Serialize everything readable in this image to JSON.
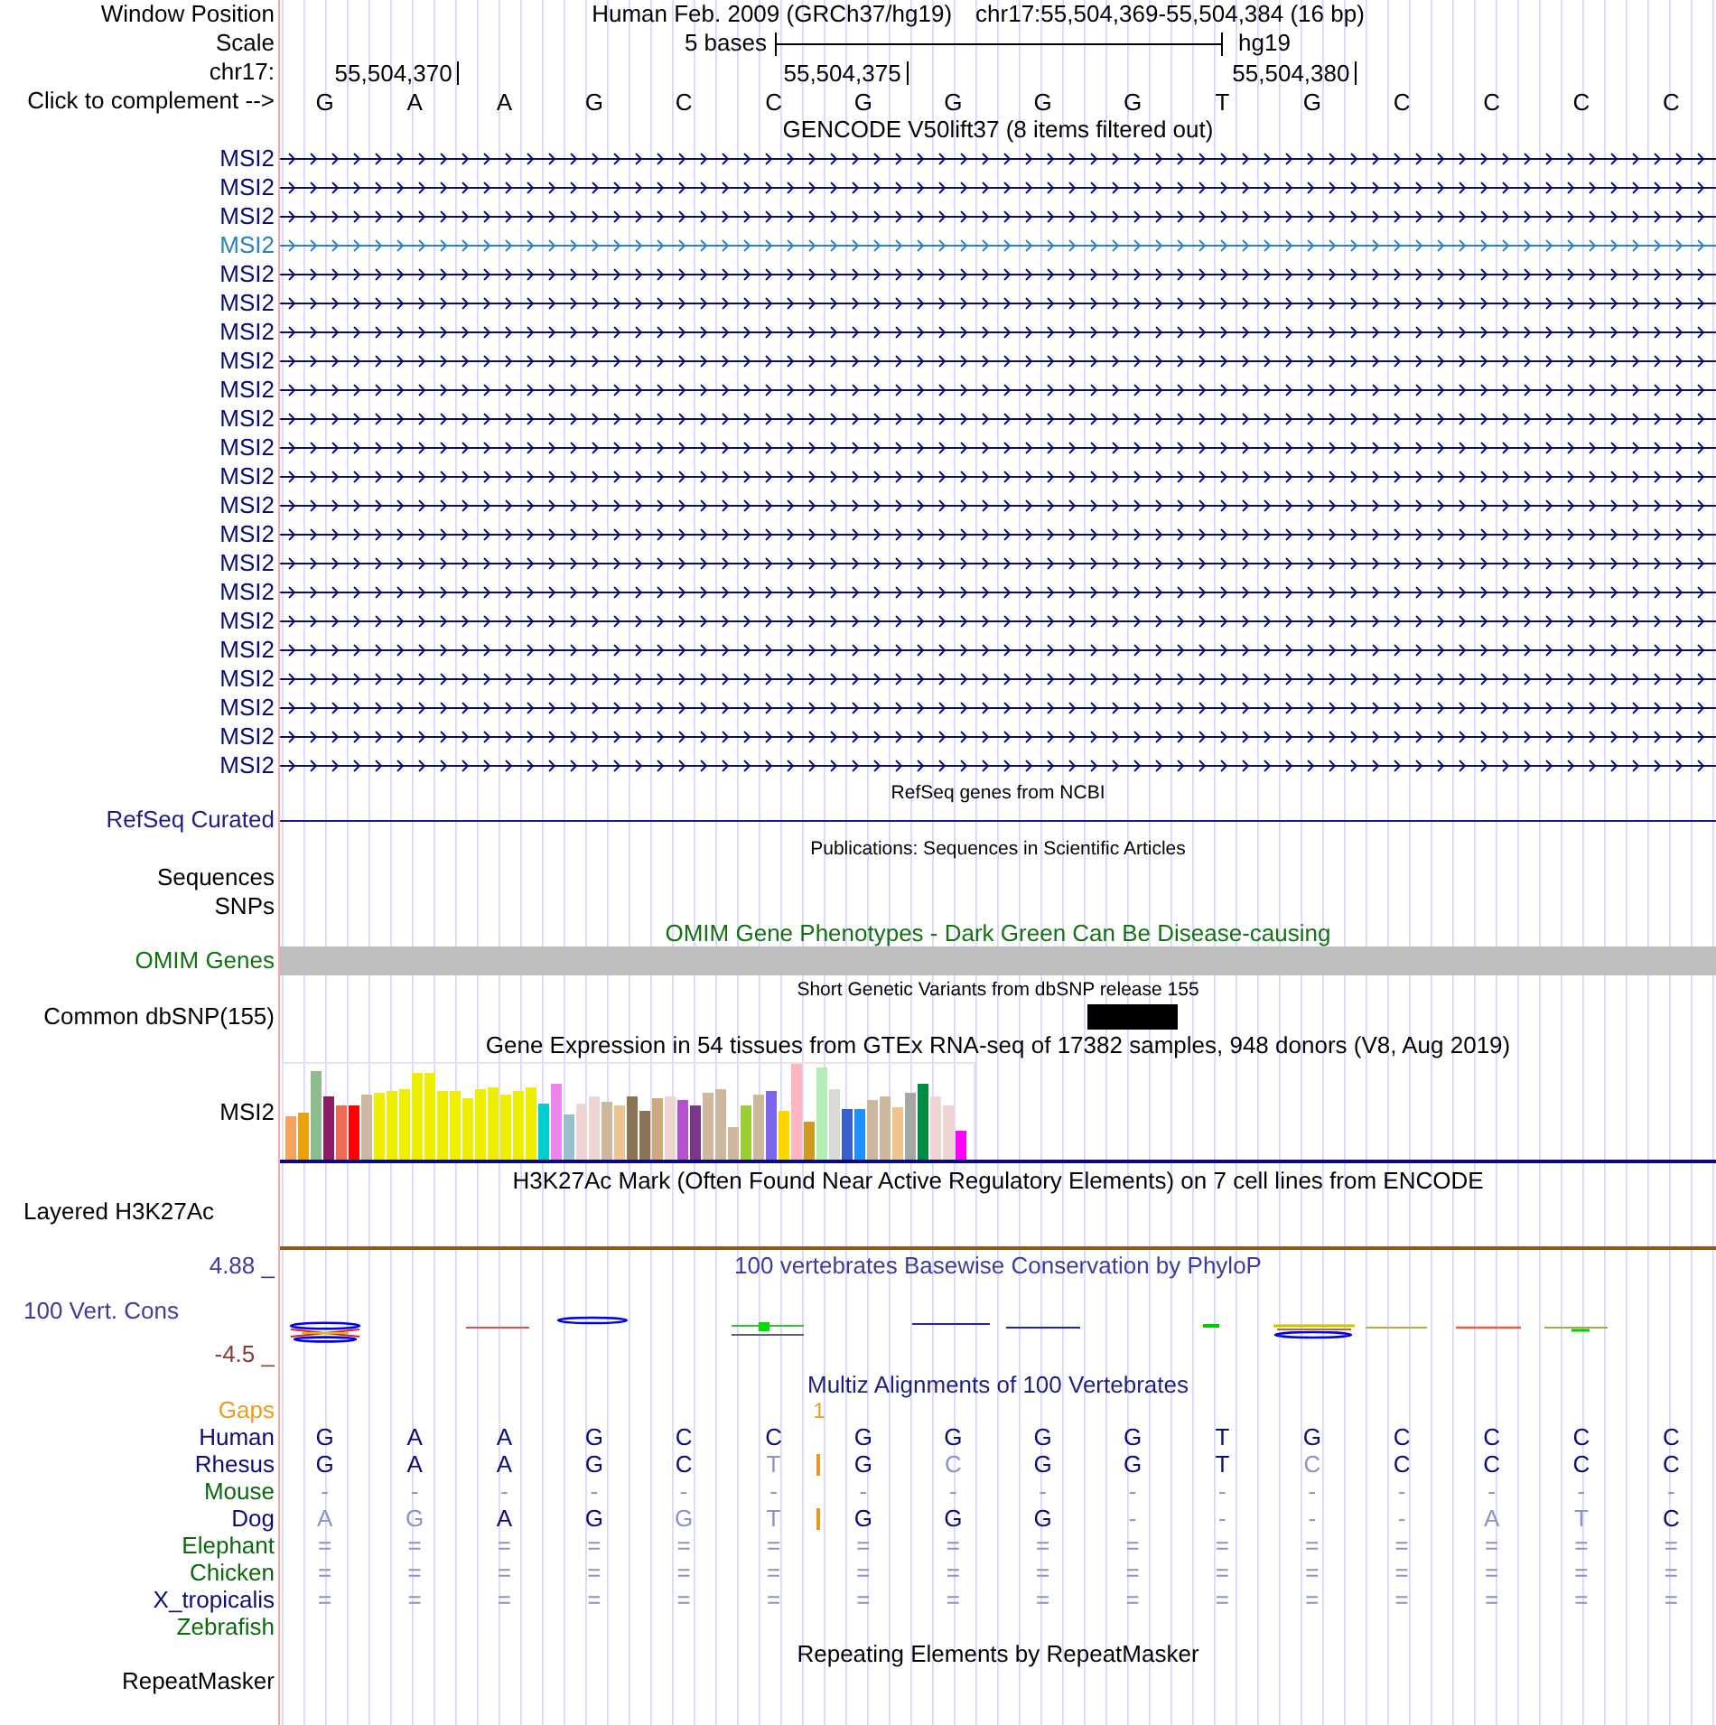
{
  "header": {
    "label": "Window Position",
    "assembly": "Human Feb. 2009 (GRCh37/hg19)",
    "position": "chr17:55,504,369-55,504,384 (16 bp)"
  },
  "scale": {
    "label": "Scale",
    "span": "5 bases",
    "assembly": "hg19"
  },
  "ruler": {
    "label": "chr17:",
    "positions": [
      "55,504,370",
      "55,504,375",
      "55,504,380"
    ]
  },
  "complement": {
    "label": "Click to complement -->",
    "bases": [
      "G",
      "A",
      "A",
      "G",
      "C",
      "C",
      "G",
      "G",
      "G",
      "G",
      "T",
      "G",
      "C",
      "C",
      "C",
      "C"
    ]
  },
  "gencode": {
    "title": "GENCODE V50lift37 (8 items filtered out)",
    "genes": [
      {
        "name": "MSI2",
        "color": "#0c0c78"
      },
      {
        "name": "MSI2",
        "color": "#0c0c78"
      },
      {
        "name": "MSI2",
        "color": "#0c0c78"
      },
      {
        "name": "MSI2",
        "color": "#2a82c4"
      },
      {
        "name": "MSI2",
        "color": "#0c0c78"
      },
      {
        "name": "MSI2",
        "color": "#0c0c78"
      },
      {
        "name": "MSI2",
        "color": "#0c0c78"
      },
      {
        "name": "MSI2",
        "color": "#0c0c78"
      },
      {
        "name": "MSI2",
        "color": "#0c0c78"
      },
      {
        "name": "MSI2",
        "color": "#0c0c78"
      },
      {
        "name": "MSI2",
        "color": "#0c0c78"
      },
      {
        "name": "MSI2",
        "color": "#0c0c78"
      },
      {
        "name": "MSI2",
        "color": "#0c0c78"
      },
      {
        "name": "MSI2",
        "color": "#0c0c78"
      },
      {
        "name": "MSI2",
        "color": "#0c0c78"
      },
      {
        "name": "MSI2",
        "color": "#0c0c78"
      },
      {
        "name": "MSI2",
        "color": "#0c0c78"
      },
      {
        "name": "MSI2",
        "color": "#0c0c78"
      },
      {
        "name": "MSI2",
        "color": "#0c0c78"
      },
      {
        "name": "MSI2",
        "color": "#0c0c78"
      },
      {
        "name": "MSI2",
        "color": "#0c0c78"
      },
      {
        "name": "MSI2",
        "color": "#0c0c78"
      }
    ]
  },
  "refseq": {
    "title": "RefSeq genes from NCBI",
    "label": "RefSeq Curated"
  },
  "publications": {
    "title": "Publications: Sequences in Scientific Articles",
    "labels": [
      "Sequences",
      "SNPs"
    ]
  },
  "omim": {
    "title": "OMIM Gene Phenotypes - Dark Green Can Be Disease-causing",
    "label": "OMIM Genes"
  },
  "dbsnp": {
    "title": "Short Genetic Variants from dbSNP release 155",
    "label": "Common dbSNP(155)"
  },
  "gtex": {
    "title": "Gene Expression in 54 tissues from GTEx RNA-seq of 17382 samples, 948 donors (V8, Aug 2019)",
    "label": "MSI2"
  },
  "h3k27ac": {
    "title": "H3K27Ac Mark (Often Found Near Active Regulatory Elements) on 7 cell lines from ENCODE",
    "label": "Layered H3K27Ac"
  },
  "phylop": {
    "title": "100 vertebrates Basewise Conservation by PhyloP",
    "label": "100 Vert. Cons",
    "max": "4.88 _",
    "min": "-4.5 _"
  },
  "multiz": {
    "title": "Multiz Alignments of 100 Vertebrates",
    "gaps": {
      "label": "Gaps",
      "count": "1"
    },
    "species": [
      {
        "name": "Human",
        "color": "#0c0c78",
        "insertion": false,
        "bases": [
          {
            "base": "G",
            "dim": false
          },
          {
            "base": "A",
            "dim": false
          },
          {
            "base": "A",
            "dim": false
          },
          {
            "base": "G",
            "dim": false
          },
          {
            "base": "C",
            "dim": false
          },
          {
            "base": "C",
            "dim": false
          },
          {
            "base": "G",
            "dim": false
          },
          {
            "base": "G",
            "dim": false
          },
          {
            "base": "G",
            "dim": false
          },
          {
            "base": "G",
            "dim": false
          },
          {
            "base": "T",
            "dim": false
          },
          {
            "base": "G",
            "dim": false
          },
          {
            "base": "C",
            "dim": false
          },
          {
            "base": "C",
            "dim": false
          },
          {
            "base": "C",
            "dim": false
          },
          {
            "base": "C",
            "dim": false
          }
        ]
      },
      {
        "name": "Rhesus",
        "color": "#0c0c78",
        "insertion": true,
        "bases": [
          {
            "base": "G",
            "dim": false
          },
          {
            "base": "A",
            "dim": false
          },
          {
            "base": "A",
            "dim": false
          },
          {
            "base": "G",
            "dim": false
          },
          {
            "base": "C",
            "dim": false
          },
          {
            "base": "T",
            "dim": true
          },
          {
            "base": "G",
            "dim": false
          },
          {
            "base": "C",
            "dim": true
          },
          {
            "base": "G",
            "dim": false
          },
          {
            "base": "G",
            "dim": false
          },
          {
            "base": "T",
            "dim": false
          },
          {
            "base": "C",
            "dim": true
          },
          {
            "base": "C",
            "dim": false
          },
          {
            "base": "C",
            "dim": false
          },
          {
            "base": "C",
            "dim": false
          },
          {
            "base": "C",
            "dim": false
          }
        ]
      },
      {
        "name": "Mouse",
        "color": "#0a690a",
        "insertion": false,
        "bases": [
          {
            "base": "-",
            "dim": true
          },
          {
            "base": "-",
            "dim": true
          },
          {
            "base": "-",
            "dim": true
          },
          {
            "base": "-",
            "dim": true
          },
          {
            "base": "-",
            "dim": true
          },
          {
            "base": "-",
            "dim": true
          },
          {
            "base": "-",
            "dim": true
          },
          {
            "base": "-",
            "dim": true
          },
          {
            "base": "-",
            "dim": true
          },
          {
            "base": "-",
            "dim": true
          },
          {
            "base": "-",
            "dim": true
          },
          {
            "base": "-",
            "dim": true
          },
          {
            "base": "-",
            "dim": true
          },
          {
            "base": "-",
            "dim": true
          },
          {
            "base": "-",
            "dim": true
          },
          {
            "base": "-",
            "dim": true
          }
        ]
      },
      {
        "name": "Dog",
        "color": "#0c0c78",
        "insertion": true,
        "bases": [
          {
            "base": "A",
            "dim": true
          },
          {
            "base": "G",
            "dim": true
          },
          {
            "base": "A",
            "dim": false
          },
          {
            "base": "G",
            "dim": false
          },
          {
            "base": "G",
            "dim": true
          },
          {
            "base": "T",
            "dim": true
          },
          {
            "base": "G",
            "dim": false
          },
          {
            "base": "G",
            "dim": false
          },
          {
            "base": "G",
            "dim": false
          },
          {
            "base": "-",
            "dim": true
          },
          {
            "base": "-",
            "dim": true
          },
          {
            "base": "-",
            "dim": true
          },
          {
            "base": "-",
            "dim": true
          },
          {
            "base": "A",
            "dim": true
          },
          {
            "base": "T",
            "dim": true
          },
          {
            "base": "C",
            "dim": false
          }
        ]
      },
      {
        "name": "Elephant",
        "color": "#0a690a",
        "insertion": false,
        "bases": [
          {
            "base": "=",
            "dim": true
          },
          {
            "base": "=",
            "dim": true
          },
          {
            "base": "=",
            "dim": true
          },
          {
            "base": "=",
            "dim": true
          },
          {
            "base": "=",
            "dim": true
          },
          {
            "base": "=",
            "dim": true
          },
          {
            "base": "=",
            "dim": true
          },
          {
            "base": "=",
            "dim": true
          },
          {
            "base": "=",
            "dim": true
          },
          {
            "base": "=",
            "dim": true
          },
          {
            "base": "=",
            "dim": true
          },
          {
            "base": "=",
            "dim": true
          },
          {
            "base": "=",
            "dim": true
          },
          {
            "base": "=",
            "dim": true
          },
          {
            "base": "=",
            "dim": true
          },
          {
            "base": "=",
            "dim": true
          }
        ]
      },
      {
        "name": "Chicken",
        "color": "#0a690a",
        "insertion": false,
        "bases": [
          {
            "base": "=",
            "dim": true
          },
          {
            "base": "=",
            "dim": true
          },
          {
            "base": "=",
            "dim": true
          },
          {
            "base": "=",
            "dim": true
          },
          {
            "base": "=",
            "dim": true
          },
          {
            "base": "=",
            "dim": true
          },
          {
            "base": "=",
            "dim": true
          },
          {
            "base": "=",
            "dim": true
          },
          {
            "base": "=",
            "dim": true
          },
          {
            "base": "=",
            "dim": true
          },
          {
            "base": "=",
            "dim": true
          },
          {
            "base": "=",
            "dim": true
          },
          {
            "base": "=",
            "dim": true
          },
          {
            "base": "=",
            "dim": true
          },
          {
            "base": "=",
            "dim": true
          },
          {
            "base": "=",
            "dim": true
          }
        ]
      },
      {
        "name": "X_tropicalis",
        "color": "#0c0c78",
        "insertion": false,
        "bases": [
          {
            "base": "=",
            "dim": true
          },
          {
            "base": "=",
            "dim": true
          },
          {
            "base": "=",
            "dim": true
          },
          {
            "base": "=",
            "dim": true
          },
          {
            "base": "=",
            "dim": true
          },
          {
            "base": "=",
            "dim": true
          },
          {
            "base": "=",
            "dim": true
          },
          {
            "base": "=",
            "dim": true
          },
          {
            "base": "=",
            "dim": true
          },
          {
            "base": "=",
            "dim": true
          },
          {
            "base": "=",
            "dim": true
          },
          {
            "base": "=",
            "dim": true
          },
          {
            "base": "=",
            "dim": true
          },
          {
            "base": "=",
            "dim": true
          },
          {
            "base": "=",
            "dim": true
          },
          {
            "base": "=",
            "dim": true
          }
        ]
      },
      {
        "name": "Zebrafish",
        "color": "#0a690a",
        "insertion": false
      }
    ]
  },
  "repeatmasker": {
    "title": "Repeating Elements by RepeatMasker",
    "label": "RepeatMasker"
  }
}
